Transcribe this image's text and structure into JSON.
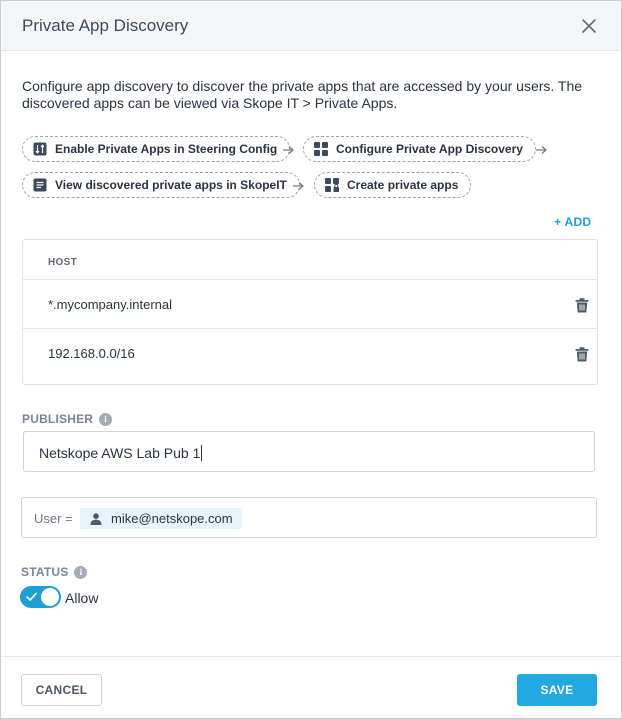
{
  "dialog": {
    "title": "Private App Discovery",
    "description": "Configure app discovery to discover the private apps that are accessed by your users. The discovered apps can be viewed via Skope IT > Private Apps."
  },
  "steps": [
    {
      "label": "Enable Private Apps in Steering Config",
      "icon": "steering-icon"
    },
    {
      "label": "Configure Private App Discovery",
      "icon": "grid-icon"
    },
    {
      "label": "View discovered private apps in SkopeIT",
      "icon": "document-icon"
    },
    {
      "label": "Create private apps",
      "icon": "app-lock-icon"
    }
  ],
  "hosts": {
    "add_label": "+ ADD",
    "column_header": "HOST",
    "rows": [
      "*.mycompany.internal",
      "192.168.0.0/16"
    ]
  },
  "publisher": {
    "label": "PUBLISHER",
    "value": "Netskope AWS Lab Pub 1"
  },
  "criteria": {
    "key": "User =",
    "value": "mike@netskope.com"
  },
  "status": {
    "label": "STATUS",
    "toggle_label": "Allow",
    "enabled": true
  },
  "footer": {
    "cancel_label": "CANCEL",
    "save_label": "SAVE"
  },
  "colors": {
    "accent": "#22a9e0",
    "link": "#1e9fd4",
    "tag_bg": "#e6f4fb"
  }
}
